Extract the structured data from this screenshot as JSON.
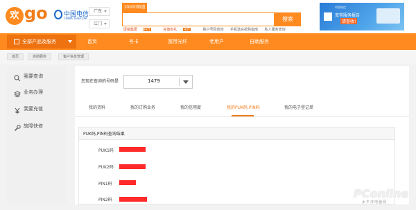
{
  "header": {
    "logo_text": "欢",
    "logo_go": "go",
    "carrier_name_cn": "中国电信",
    "carrier_name_en": "CHINA TELECOM",
    "province_select": "广东",
    "city_select": "江门",
    "search_tab_label": "10000知道",
    "search_placeholder": "",
    "search_button": "搜索",
    "hot_links": [
      "促销集团",
      "充值有礼",
      "携户号码查询",
      "手机选充抢购指南",
      "私人服务查询"
    ],
    "hot_badge": "HOT"
  },
  "banner": {
    "small_text": "中国电信",
    "line1": "宽带服务报告",
    "line2": "请查收!"
  },
  "nav": {
    "all_products": "全部产品及服务",
    "items": [
      "首页",
      "号卡",
      "宽带光纤",
      "老用户",
      "自助服务"
    ]
  },
  "breadcrumb": [
    "首页",
    "自助服务",
    "客户信息管理"
  ],
  "sidebar": {
    "items": [
      {
        "label": "我要查询",
        "icon": "search-icon"
      },
      {
        "label": "业务办理",
        "icon": "layers-icon"
      },
      {
        "label": "我要充值",
        "icon": "yen-icon"
      },
      {
        "label": "故障快修",
        "icon": "wrench-icon"
      }
    ]
  },
  "query": {
    "label": "您现在查询的号码是",
    "value": "1479"
  },
  "tabs": {
    "items": [
      "我的资料",
      "我的订购业务",
      "我的信用度",
      "我的PUK码,PIN码",
      "我的电子登记单"
    ],
    "active_index": 3
  },
  "result": {
    "title": "PUK码,PIN码查询结果",
    "rows": [
      "PUK1码",
      "PUK2码",
      "PIN1码",
      "PIN2码"
    ]
  },
  "watermark": {
    "main": "PConline",
    "sub": "太平洋电脑网"
  },
  "colors": {
    "brand_orange": "#ff8a1f",
    "redaction": "#ff2a2a"
  }
}
